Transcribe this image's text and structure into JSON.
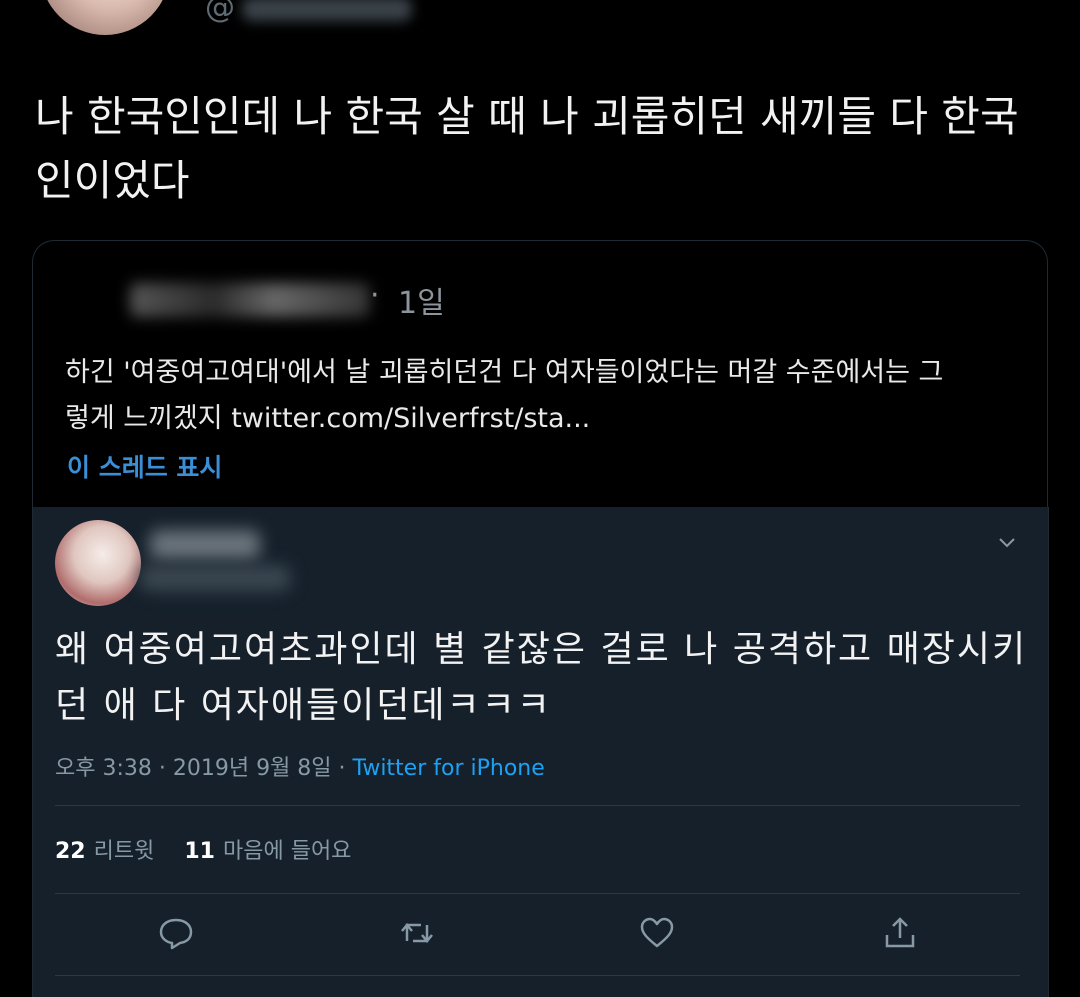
{
  "top_tweet": {
    "handle": "@",
    "text": "나 한국인인데 나 한국 살 때 나 괴롭히던 새끼들 다 한국인이었다"
  },
  "quoted_tweet": {
    "separator": "·",
    "time": "1일",
    "text": "하긴 '여중여고여대'에서 날 괴롭히던건 다 여자들이었다는 머갈 수준에서는 그렇게 느끼겠지 twitter.com/Silverfrst/sta...",
    "show_thread": "이 스레드 표시"
  },
  "main_tweet": {
    "text": "왜 여중여고여초과인데 별 같잖은 걸로 나 공격하고 매장시키던 애 다 여자애들이던데ㅋㅋㅋ",
    "timestamp": "오후 3:38 · 2019년 9월 8일 · ",
    "client": "Twitter for iPhone",
    "retweet_count": "22",
    "retweet_label": "리트윗",
    "like_count": "11",
    "like_label": "마음에 들어요"
  },
  "icons": [
    "reply-icon",
    "retweet-icon",
    "like-icon",
    "share-icon",
    "chevron-down-icon"
  ],
  "colors": {
    "background": "#000000",
    "panel": "#15202b",
    "link": "#1da1f2",
    "muted": "#8899a6"
  }
}
